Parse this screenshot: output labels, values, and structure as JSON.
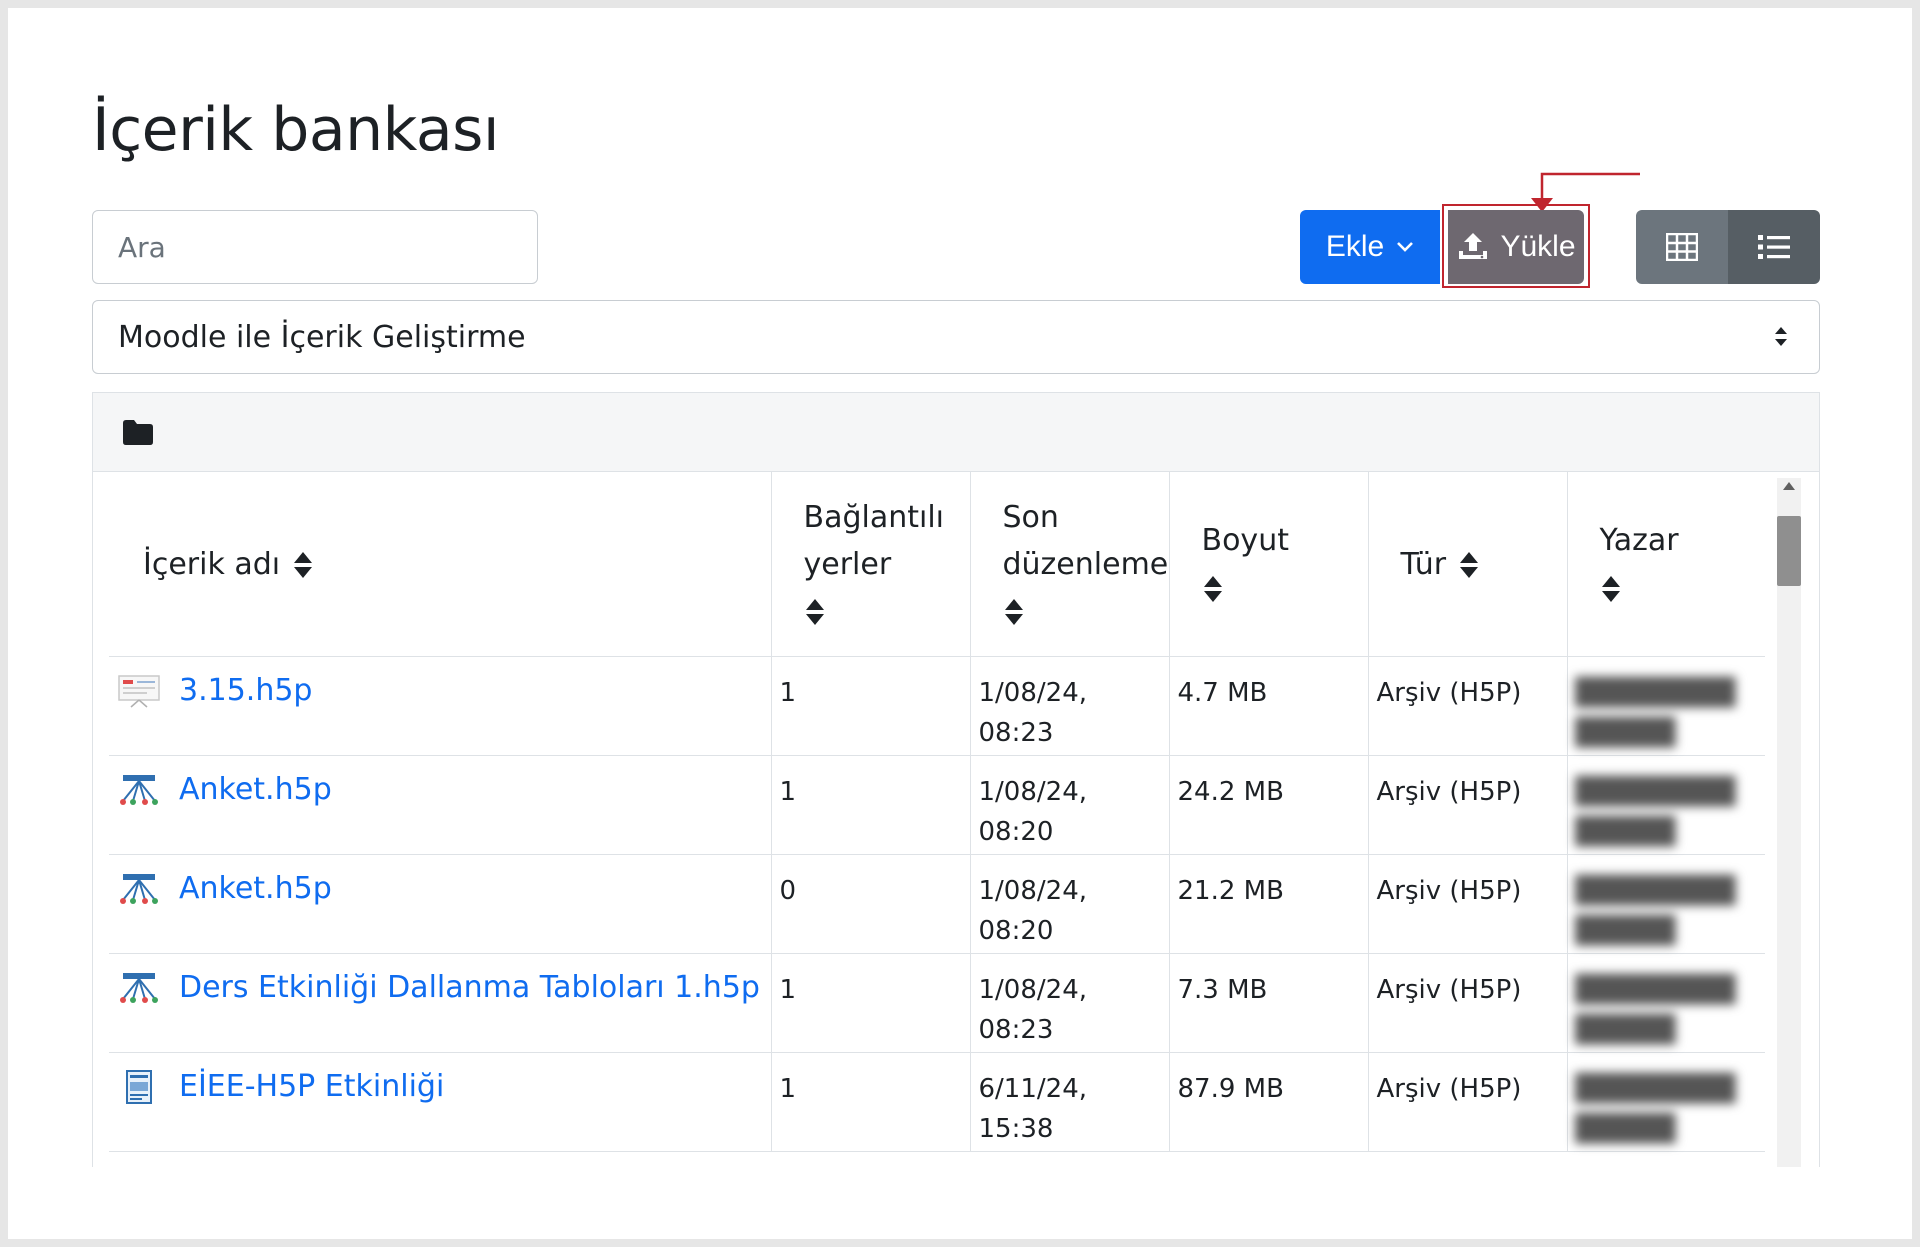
{
  "page": {
    "title": "İçerik bankası"
  },
  "search": {
    "placeholder": "Ara"
  },
  "toolbar": {
    "add_label": "Ekle",
    "upload_label": "Yükle",
    "grid_view_icon": "grid-icon",
    "list_view_icon": "list-icon"
  },
  "context_select": {
    "value": "Moodle ile İçerik Geliştirme"
  },
  "table": {
    "headers": {
      "name": "İçerik adı",
      "used_line1": "Bağlantılı",
      "used_line2": "yerler",
      "modified_line1": "Son",
      "modified_line2": "düzenleme",
      "size": "Boyut",
      "type": "Tür",
      "author": "Yazar"
    },
    "rows": [
      {
        "name": "3.15.h5p",
        "icon": "presentation-icon",
        "used": "1",
        "modified": "1/08/24, 08:23",
        "size": "4.7 MB",
        "type": "Arşiv (H5P)"
      },
      {
        "name": "Anket.h5p",
        "icon": "branching-icon",
        "used": "1",
        "modified": "1/08/24, 08:20",
        "size": "24.2 MB",
        "type": "Arşiv (H5P)"
      },
      {
        "name": "Anket.h5p",
        "icon": "branching-icon",
        "used": "0",
        "modified": "1/08/24, 08:20",
        "size": "21.2 MB",
        "type": "Arşiv (H5P)"
      },
      {
        "name": "Ders Etkinliği Dallanma Tabloları 1.h5p",
        "icon": "branching-icon",
        "used": "1",
        "modified": "1/08/24, 08:23",
        "size": "7.3 MB",
        "type": "Arşiv (H5P)"
      },
      {
        "name": "EİEE-H5P Etkinliği",
        "icon": "interactive-book-icon",
        "used": "1",
        "modified": "6/11/24, 15:38",
        "size": "87.9 MB",
        "type": "Arşiv (H5P)"
      }
    ]
  },
  "colors": {
    "primary": "#0f6cf0",
    "secondary": "#6c757d",
    "highlight": "#c0252e"
  }
}
